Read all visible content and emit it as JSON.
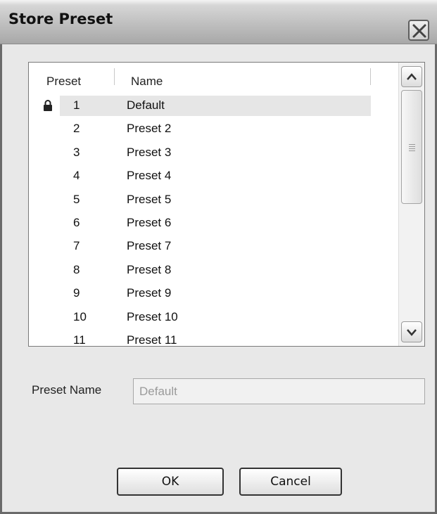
{
  "window": {
    "title": "Store Preset",
    "close_icon": "close-icon"
  },
  "list": {
    "columns": [
      "Preset",
      "Name"
    ],
    "rows": [
      {
        "num": "1",
        "name": "Default",
        "locked": true,
        "selected": true
      },
      {
        "num": "2",
        "name": "Preset 2"
      },
      {
        "num": "3",
        "name": "Preset 3"
      },
      {
        "num": "4",
        "name": "Preset 4"
      },
      {
        "num": "5",
        "name": "Preset 5"
      },
      {
        "num": "6",
        "name": "Preset 6"
      },
      {
        "num": "7",
        "name": "Preset 7"
      },
      {
        "num": "8",
        "name": "Preset 8"
      },
      {
        "num": "9",
        "name": "Preset 9"
      },
      {
        "num": "10",
        "name": "Preset 10"
      },
      {
        "num": "11",
        "name": "Preset 11"
      }
    ]
  },
  "form": {
    "preset_name_label": "Preset Name",
    "preset_name_value": "Default"
  },
  "buttons": {
    "ok": "OK",
    "cancel": "Cancel"
  }
}
